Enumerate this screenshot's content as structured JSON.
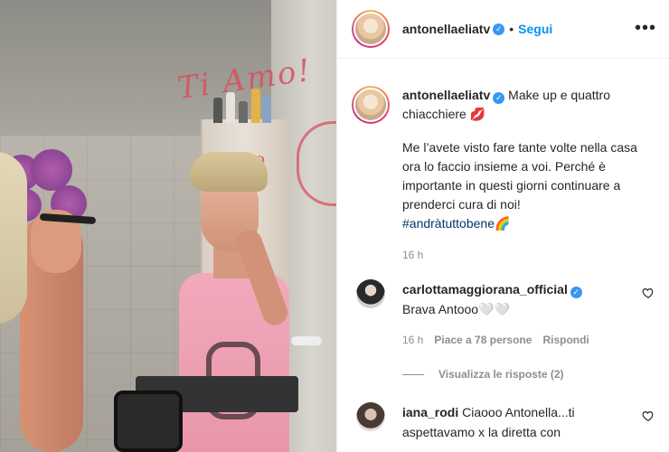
{
  "post": {
    "author": {
      "username": "antonellaeliatv",
      "verified": true,
      "follow_label": "Segui",
      "separator": "•"
    },
    "more_icon": "more-options-icon",
    "photo": {
      "mirror_writing_1": "Ti Amo!",
      "mirror_writing_2": "Pietro"
    },
    "caption": {
      "username": "antonellaeliatv",
      "line1": "Make up e quattro chiacchiere 💋",
      "paragraph": "Me l’avete visto fare tante volte nella casa ora lo faccio insieme a voi. Perché è importante in questi giorni continuare a prenderci cura di noi!",
      "hashtag": "#andràtuttobene🌈",
      "time": "16 h"
    },
    "comments": [
      {
        "username": "carlottamaggiorana_official",
        "verified": true,
        "text": "Brava Antooo🤍🤍",
        "time": "16 h",
        "likes_label": "Piace a 78 persone",
        "reply_label": "Rispondi",
        "view_replies_label": "Visualizza le risposte (2)"
      },
      {
        "username": "iana_rodi",
        "text": "Ciaooo Antonella...ti aspettavamo x la diretta con"
      }
    ],
    "colors": {
      "link_blue": "#0095f6",
      "verified_blue": "#3897f0",
      "hashtag": "#00376b",
      "muted": "#8e8e8e"
    }
  }
}
